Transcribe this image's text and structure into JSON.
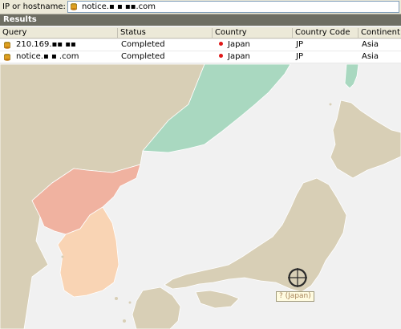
{
  "toolbar": {
    "label": "IP or hostname:",
    "host_value": "notice.▪ ▪ ▪▪.com"
  },
  "results": {
    "title": "Results",
    "columns": [
      "Query",
      "Status",
      "Country",
      "Country Code",
      "Continent"
    ],
    "rows": [
      {
        "query": "210.169.▪▪ ▪▪",
        "status": "Completed",
        "country": "Japan",
        "code": "JP",
        "continent": "Asia"
      },
      {
        "query": "notice.▪ ▪ .com",
        "status": "Completed",
        "country": "Japan",
        "code": "JP",
        "continent": "Asia"
      }
    ]
  },
  "map": {
    "marker_label": "? (Japan)"
  },
  "colors": {
    "sea": "#f1f1f1",
    "land": "#d8cfb6",
    "japan": "#d8cfb6",
    "north_korea": "#f0b2a0",
    "south_korea": "#f9d4b4",
    "russia": "#a9d8c0",
    "header": "#6e6e63"
  },
  "icons": [
    "database-icon",
    "country-dot-icon",
    "crosshair-icon"
  ]
}
